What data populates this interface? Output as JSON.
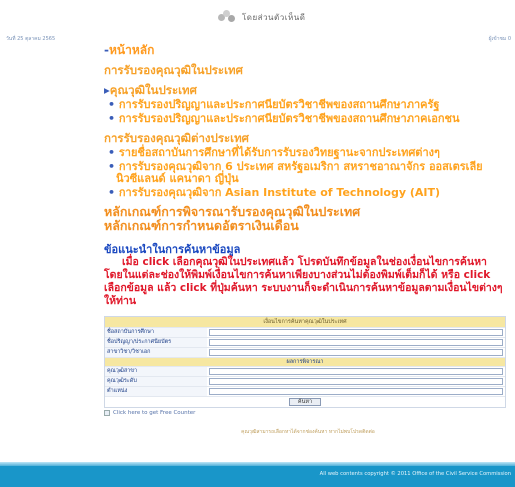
{
  "header": {
    "logo_icon": "dots-logo-icon",
    "site_title": "โดยส่วนตัวเห็นดี",
    "left_strip": "วันที่ 25 ตุลาคม 2565",
    "right_strip": "ผู้เข้าชม 0"
  },
  "menu": {
    "home": "หน้าหลัก",
    "s1_title": "การรับรองคุณวุฒิในประเทศ",
    "s2_title": "คุณวุฒิในประเทศ",
    "s2_items": [
      "การรับรองปริญญาและประกาศนียบัตรวิชาชีพของสถานศึกษาภาครัฐ",
      "การรับรองปริญญาและประกาศนียบัตรวิชาชีพของสถานศึกษาภาคเอกชน"
    ],
    "s3_title": "การรับรองคุณวุฒิต่างประเทศ",
    "s3_items": [
      "รายชื่อสถาบันการศึกษาที่ได้รับการรับรองวิทยฐานะจากประเทศต่างๆ",
      "การรับรองคุณวุฒิจาก 6 ประเทศ สหรัฐอเมริกา สหราชอาณาจักร ออสเตรเลีย นิวซีแลนด์ แคนาดา ญี่ปุ่น",
      "การรับรองคุณวุฒิจาก Asian Institute of Technology (AIT)"
    ],
    "criteria1": "หลักเกณฑ์การพิจารณารับรองคุณวุฒิในประเทศ",
    "criteria2": "หลักเกณฑ์การกำหนดอัตราเงินเดือน"
  },
  "howto": {
    "title": "ข้อแนะนำในการค้นหาข้อมูล",
    "text": "เมื่อ click เลือกคุณวุฒิในประเทศแล้ว โปรดบันทึกข้อมูลในช่องเงื่อนไขการค้นหา โดยในแต่ละช่องให้พิมพ์เงื่อนไขการค้นหาเพียงบางส่วนไม่ต้องพิมพ์เต็มก็ได้ หรือ click เลือกข้อมูล แล้ว click ที่ปุ่มค้นหา ระบบงานก็จะดำเนินการค้นหาข้อมูลตามเงื่อนไขต่างๆ ให้ท่าน"
  },
  "form": {
    "header": "เงื่อนไขการค้นหาคุณวุฒิในประเทศ",
    "fields": [
      "ชื่อสถาบันการศึกษา",
      "ชื่อปริญญา/ประกาศนียบัตร",
      "สาขาวิชา/วิชาเอก"
    ],
    "subheader": "ผลการพิจารณา",
    "fields2": [
      "คุณวุฒิสาขา",
      "คุณวุฒิระดับ",
      "ตำแหน่ง"
    ],
    "button": "ค้นหา"
  },
  "counter": "Click here to get Free Counter",
  "note": "คุณวุฒิสามารถเลือกหาได้จากช่องค้นหา หากไม่พบโปรดติดต่อ",
  "footer": "All web contents copyright © 2011 Office of the Civil Service Commission"
}
